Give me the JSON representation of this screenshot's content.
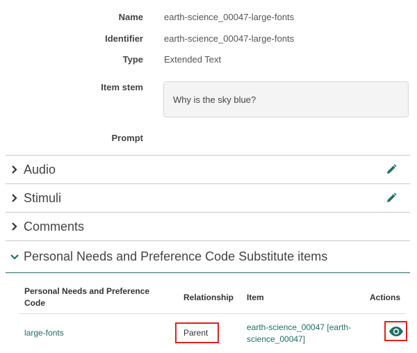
{
  "fields": {
    "name_label": "Name",
    "name_value": "earth-science_00047-large-fonts",
    "identifier_label": "Identifier",
    "identifier_value": "earth-science_00047-large-fonts",
    "type_label": "Type",
    "type_value": "Extended Text",
    "item_stem_label": "Item stem",
    "item_stem_value": "Why is the sky blue?",
    "prompt_label": "Prompt"
  },
  "sections": {
    "audio": "Audio",
    "stimuli": "Stimuli",
    "comments": "Comments",
    "pnp": "Personal Needs and Preference Code Substitute items"
  },
  "pnp_table": {
    "headers": {
      "code_line1": "Personal Needs and Preference",
      "code_line2": "Code",
      "relationship": "Relationship",
      "item": "Item",
      "actions": "Actions"
    },
    "rows": [
      {
        "code": "large-fonts",
        "relationship": "Parent",
        "item_line1": "earth-science_00047 [earth-",
        "item_line2": "science_00047]"
      }
    ]
  },
  "colors": {
    "accent": "#1f6e63",
    "highlight": "#e02020"
  }
}
